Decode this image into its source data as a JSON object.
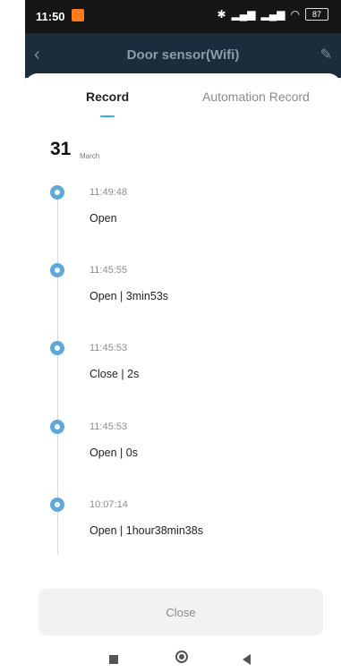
{
  "status_bar": {
    "time": "11:50",
    "battery": "87",
    "icons": [
      "bluetooth-icon",
      "signal-icon",
      "signal-icon",
      "wifi-icon",
      "battery-icon"
    ]
  },
  "app_bar": {
    "title": "Door sensor(Wifi)",
    "back_icon": "chevron-left-icon",
    "edit_icon": "edit-icon"
  },
  "tabs": [
    {
      "label": "Record",
      "active": true
    },
    {
      "label": "Automation Record",
      "active": false
    }
  ],
  "date": {
    "day": "31",
    "month": "March"
  },
  "records": [
    {
      "time": "11:49:48",
      "desc": "Open"
    },
    {
      "time": "11:45:55",
      "desc": "Open  | 3min53s"
    },
    {
      "time": "11:45:53",
      "desc": "Close  | 2s"
    },
    {
      "time": "11:45:53",
      "desc": "Open  | 0s"
    },
    {
      "time": "10:07:14",
      "desc": "Open  | 1hour38min38s"
    }
  ],
  "close_button": {
    "label": "Close"
  },
  "colors": {
    "accent": "#3aa7ea",
    "dot": "#5ea8dc",
    "app_bar": "#1c2c3c"
  }
}
